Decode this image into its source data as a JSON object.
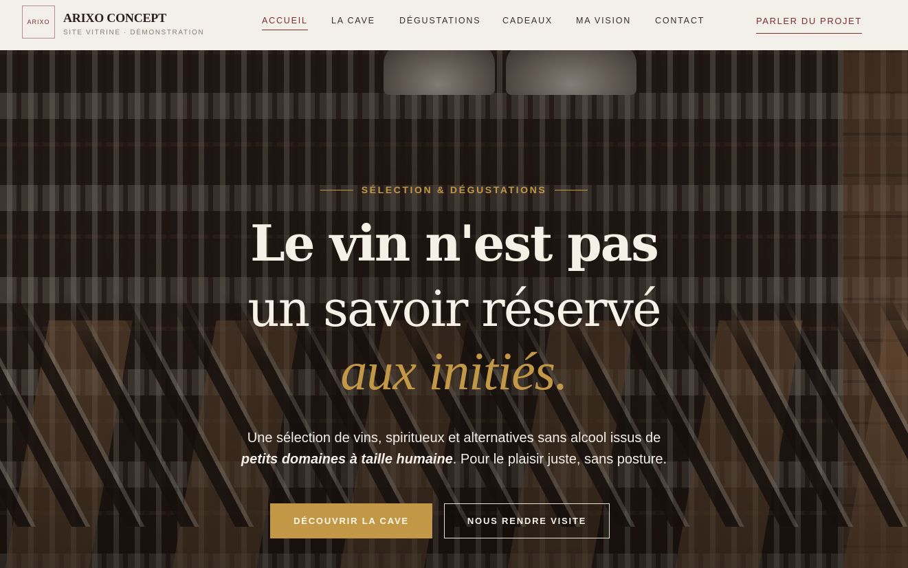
{
  "header": {
    "logo_text": "ARIXO",
    "brand_title": "ARIXO CONCEPT",
    "brand_subtitle": "SITE VITRINE · DÉMONSTRATION",
    "nav": [
      {
        "label": "ACCUEIL",
        "active": true
      },
      {
        "label": "LA CAVE",
        "active": false
      },
      {
        "label": "DÉGUSTATIONS",
        "active": false
      },
      {
        "label": "CADEAUX",
        "active": false
      },
      {
        "label": "MA VISION",
        "active": false
      },
      {
        "label": "CONTACT",
        "active": false
      }
    ],
    "cta_label": "PARLER DU PROJET"
  },
  "hero": {
    "eyebrow": "SÉLECTION & DÉGUSTATIONS",
    "headline_line1": "Le vin n'est pas",
    "headline_line2": "un savoir réservé",
    "headline_line3": "aux initiés.",
    "lede_part1": "Une sélection de vins, spiritueux et alternatives sans alcool issus de",
    "lede_emphasis": "petits domaines à taille humaine",
    "lede_part2": ". Pour le plaisir juste, sans posture.",
    "primary_button": "DÉCOUVRIR LA CAVE",
    "secondary_button": "NOUS RENDRE VISITE"
  },
  "colors": {
    "header_bg": "#f3efe9",
    "accent_wine": "#7a2e2e",
    "accent_gold": "#c29746",
    "headline_text": "#f6f0e6"
  }
}
